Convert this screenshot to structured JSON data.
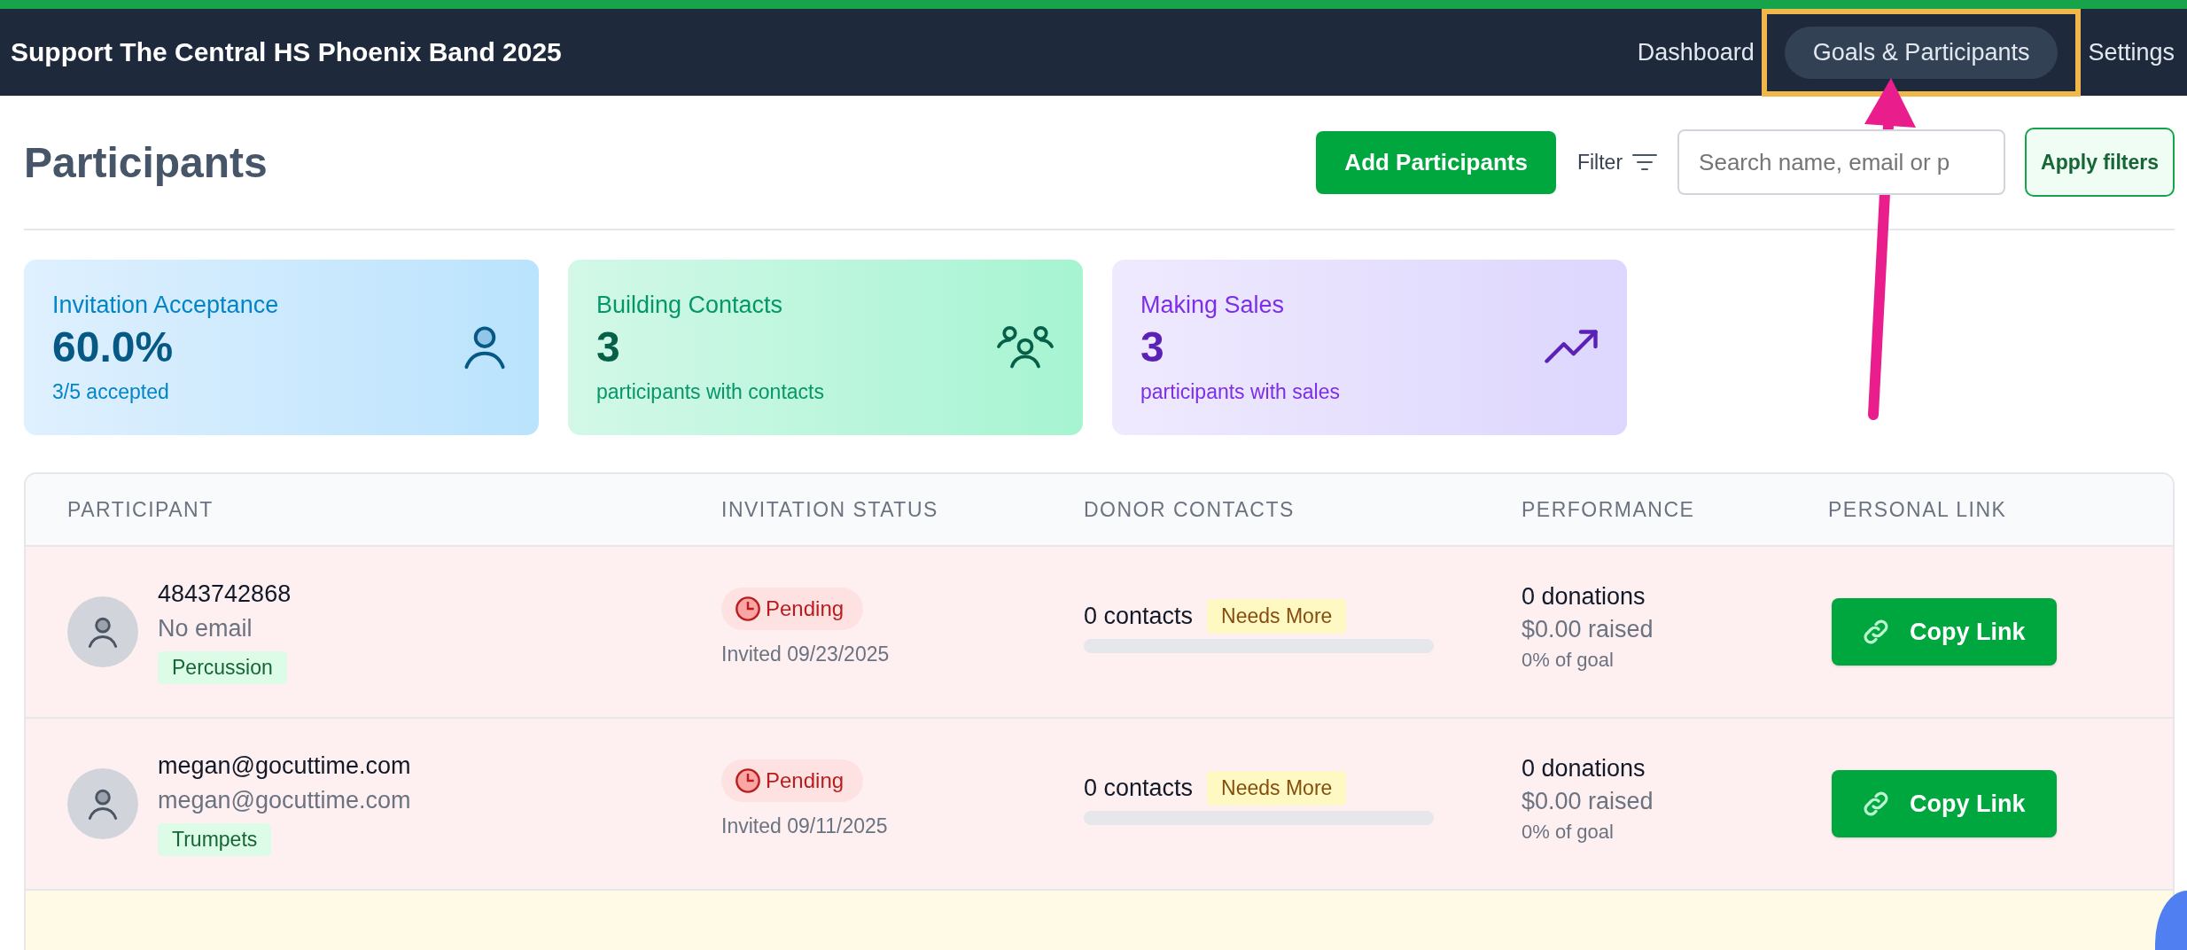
{
  "navbar": {
    "title": "Support The Central HS Phoenix Band 2025",
    "links": [
      {
        "label": "Dashboard",
        "selected": false
      },
      {
        "label": "Goals & Participants",
        "selected": true
      },
      {
        "label": "Settings",
        "selected": false
      }
    ]
  },
  "header": {
    "title": "Participants",
    "add_button": "Add Participants",
    "filter_label": "Filter",
    "search": {
      "placeholder": "Search name, email or p"
    },
    "apply_button": "Apply filters"
  },
  "stats": [
    {
      "kind": "invitations",
      "title": "Invitation Acceptance",
      "value": "60.0%",
      "caption": "3/5 accepted"
    },
    {
      "kind": "contacts",
      "title": "Building Contacts",
      "value": "3",
      "caption": "participants with contacts"
    },
    {
      "kind": "sales",
      "title": "Making Sales",
      "value": "3",
      "caption": "participants with sales"
    }
  ],
  "table": {
    "columns": [
      "PARTICIPANT",
      "INVITATION STATUS",
      "DONOR CONTACTS",
      "PERFORMANCE",
      "PERSONAL LINK"
    ],
    "rows": [
      {
        "kind": "pending",
        "name": "4843742868",
        "email": "No email",
        "section": "Percussion",
        "status": "Pending",
        "invited": "Invited 09/23/2025",
        "contacts": "0 contacts",
        "contacts_badge": "Needs More",
        "level": 0,
        "donations": "0 donations",
        "raised": "$0.00 raised",
        "goal": "0% of goal",
        "link_button": "Copy Link"
      },
      {
        "kind": "pending",
        "name": "megan@gocuttime.com",
        "email": "megan@gocuttime.com",
        "section": "Trumpets",
        "status": "Pending",
        "invited": "Invited 09/11/2025",
        "contacts": "0 contacts",
        "contacts_badge": "Needs More",
        "level": 0,
        "donations": "0 donations",
        "raised": "$0.00 raised",
        "goal": "0% of goal",
        "link_button": "Copy Link"
      },
      {
        "kind": "partial"
      }
    ]
  }
}
